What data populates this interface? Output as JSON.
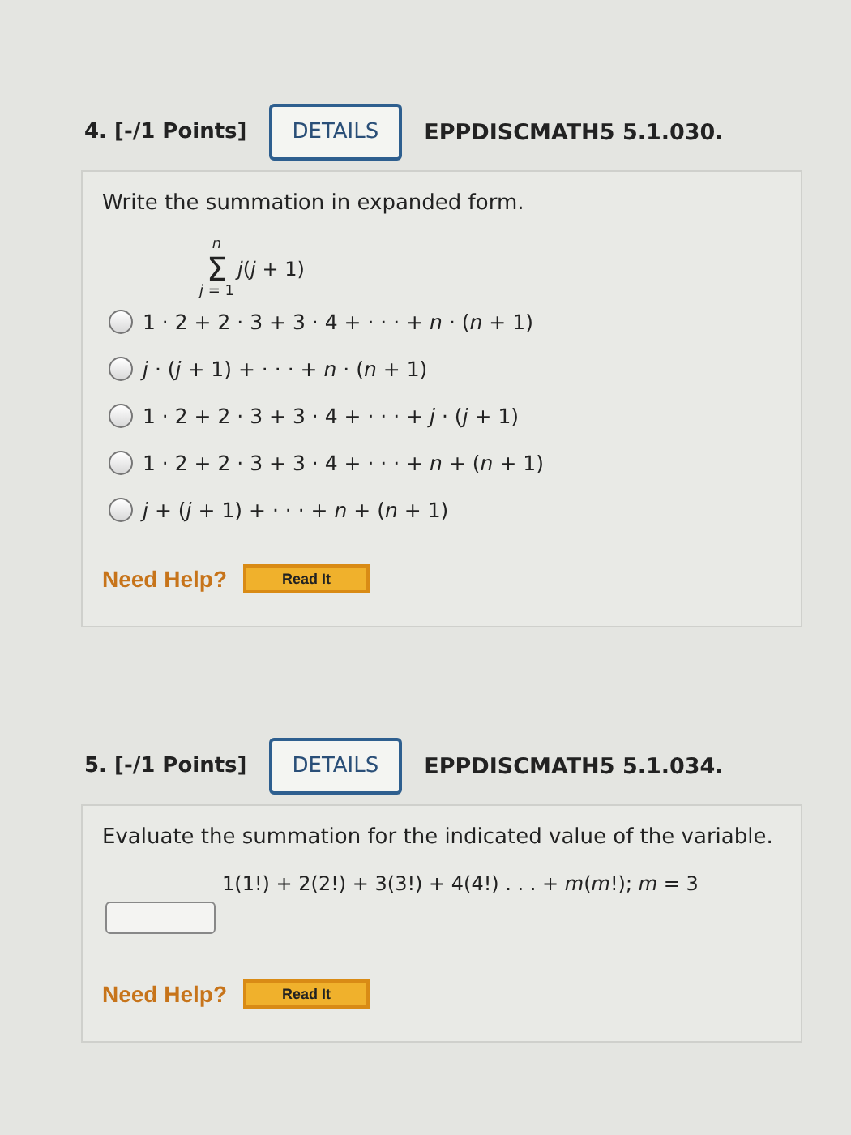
{
  "questions": [
    {
      "kind": "choice",
      "number": "4.",
      "points": "[-/1 Points]",
      "details": "DETAILS",
      "code": "EPPDISCMATH5 5.1.030.",
      "prompt": "Write the summation in expanded form.",
      "sum": {
        "sigma": "Σ",
        "upper": "*n*",
        "lower": "*j* = 1",
        "body": "*j*(*j* + 1)"
      },
      "options": [
        {
          "text": "1 · 2 + 2 · 3 + 3 · 4 + · · · + *n* · (*n* + 1)",
          "selected": false
        },
        {
          "text": "*j* · (*j* + 1) + · · · + *n* · (*n* + 1)",
          "selected": false
        },
        {
          "text": "1 · 2 + 2 · 3 + 3 · 4 + · · · + *j* · (*j* + 1)",
          "selected": false
        },
        {
          "text": "1 · 2 + 2 · 3 + 3 · 4 + · · · + *n* + (*n* + 1)",
          "selected": false
        },
        {
          "text": "*j* + (*j* + 1) + · · · + *n* + (*n* + 1)",
          "selected": false
        }
      ],
      "help": "Need Help?",
      "read": "Read It"
    },
    {
      "kind": "answer",
      "number": "5.",
      "points": "[-/1 Points]",
      "details": "DETAILS",
      "code": "EPPDISCMATH5 5.1.034.",
      "prompt": "Evaluate the summation for the indicated value of the variable.",
      "formula": "1(1!) + 2(2!) + 3(3!) + 4(4!) . . . + *m*(*m*!); *m* = 3",
      "help": "Need Help?",
      "read": "Read It"
    }
  ]
}
